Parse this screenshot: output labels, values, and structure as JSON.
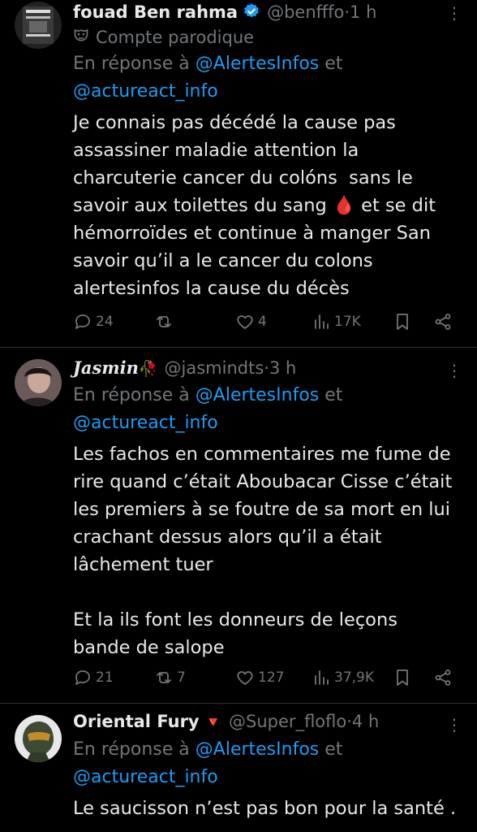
{
  "tweets": [
    {
      "name": "fouad Ben rahma",
      "verified": true,
      "handle": "@benfffo",
      "time": "1 h",
      "label": "Compte parodique",
      "reply_prefix": "En réponse à ",
      "mention1": "@AlertesInfos",
      "reply_and": " et",
      "mention2": "@actureact_info",
      "text": "Je connais pas décédé la cause pas\nassassiner maladie attention la\ncharcuterie cancer du colóns  sans le\nsavoir aux toilettes du sang 🩸 et se dit\nhémorroïdes et continue à manger San\nsavoir qu’il a le cancer du colons\nalertesinfos la cause du décès",
      "replies": "24",
      "retweets": "",
      "likes": "4",
      "views": "17K"
    },
    {
      "name": "Jasmin",
      "name_emoji": "🥀",
      "handle": "@jasmindts",
      "time": "3 h",
      "reply_prefix": "En réponse à ",
      "mention1": "@AlertesInfos",
      "reply_and": " et",
      "mention2": "@actureact_info",
      "text": "Les fachos en commentaires me fume de\nrire quand c’était Aboubacar Cisse c’était\nles premiers à se foutre de sa mort en lui\ncrachant dessus alors qu’il a était\nlâchement tuer\n\nEt la ils font les donneurs de leçons\nbande de salope",
      "replies": "21",
      "retweets": "7",
      "likes": "127",
      "views": "37,9K"
    },
    {
      "name": "Oriental Fury",
      "name_emoji": "🔻",
      "handle": "@Super_floflo",
      "time": "4 h",
      "reply_prefix": "En réponse à ",
      "mention1": "@AlertesInfos",
      "reply_and": " et",
      "mention2": "@actureact_info",
      "text": "Le saucisson n’est pas bon pour la santé ."
    }
  ],
  "dot": " · ",
  "more_glyph": "⋮",
  "colors": {
    "background": "#000000",
    "accent": "#1d9bf0",
    "muted": "#71767b",
    "text": "#e7e9ea",
    "verified": "#1d9bf0",
    "emoji_red": "#e0245e"
  }
}
